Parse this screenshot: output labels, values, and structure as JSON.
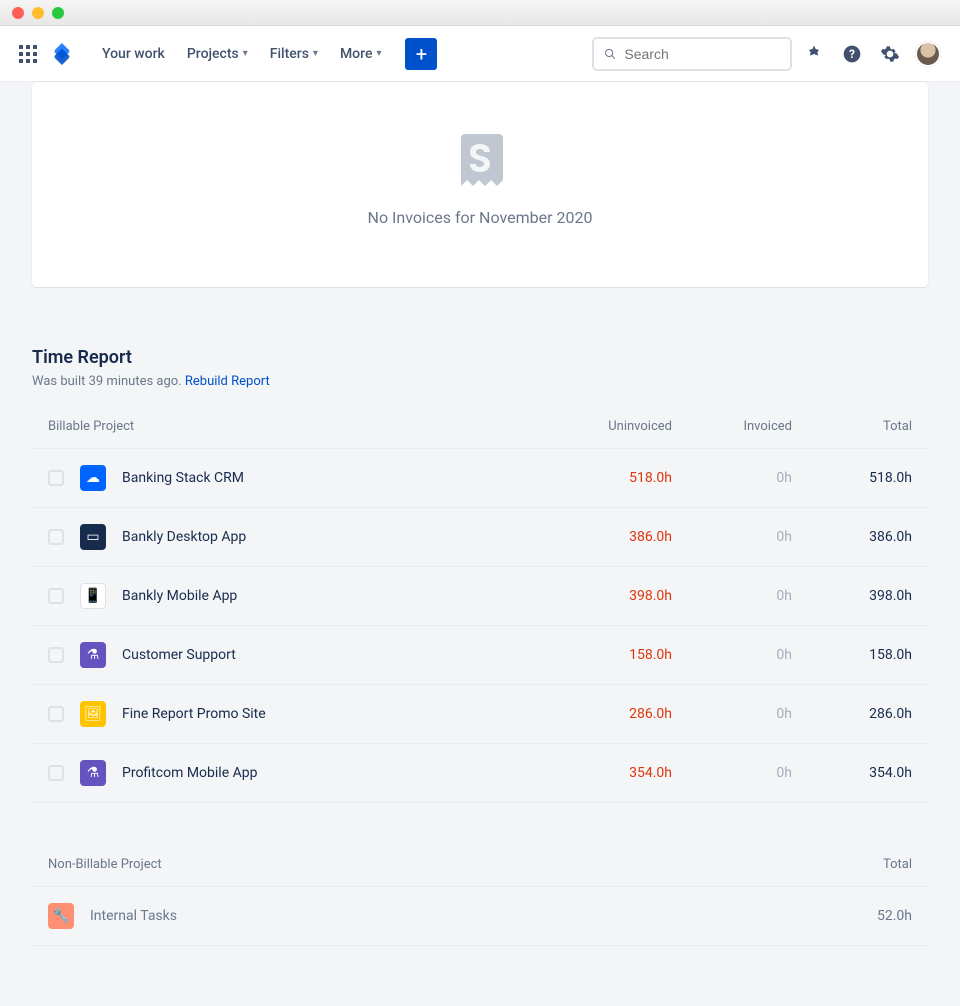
{
  "nav": {
    "your_work": "Your work",
    "projects": "Projects",
    "filters": "Filters",
    "more": "More",
    "search_placeholder": "Search"
  },
  "empty_state": {
    "message": "No Invoices for November 2020"
  },
  "report": {
    "title": "Time Report",
    "subtitle_prefix": "Was built 39 minutes ago. ",
    "rebuild_link": "Rebuild Report",
    "columns": {
      "project": "Billable Project",
      "uninvoiced": "Uninvoiced",
      "invoiced": "Invoiced",
      "total": "Total"
    },
    "rows": [
      {
        "name": "Banking Stack CRM",
        "uninvoiced": "518.0h",
        "invoiced": "0h",
        "total": "518.0h",
        "icon_bg": "#0065ff",
        "icon_glyph": "☁"
      },
      {
        "name": "Bankly Desktop App",
        "uninvoiced": "386.0h",
        "invoiced": "0h",
        "total": "386.0h",
        "icon_bg": "#172b4d",
        "icon_glyph": "▭"
      },
      {
        "name": "Bankly Mobile App",
        "uninvoiced": "398.0h",
        "invoiced": "0h",
        "total": "398.0h",
        "icon_bg": "#ffffff",
        "icon_glyph": "📱"
      },
      {
        "name": "Customer Support",
        "uninvoiced": "158.0h",
        "invoiced": "0h",
        "total": "158.0h",
        "icon_bg": "#6554c0",
        "icon_glyph": "⚗"
      },
      {
        "name": "Fine Report Promo Site",
        "uninvoiced": "286.0h",
        "invoiced": "0h",
        "total": "286.0h",
        "icon_bg": "#ffc400",
        "icon_glyph": "🖼"
      },
      {
        "name": "Profitcom Mobile App",
        "uninvoiced": "354.0h",
        "invoiced": "0h",
        "total": "354.0h",
        "icon_bg": "#6554c0",
        "icon_glyph": "⚗"
      }
    ],
    "nb_columns": {
      "project": "Non-Billable Project",
      "total": "Total"
    },
    "nb_rows": [
      {
        "name": "Internal Tasks",
        "total": "52.0h",
        "icon_bg": "#ff8f73",
        "icon_glyph": "🔧"
      }
    ]
  }
}
